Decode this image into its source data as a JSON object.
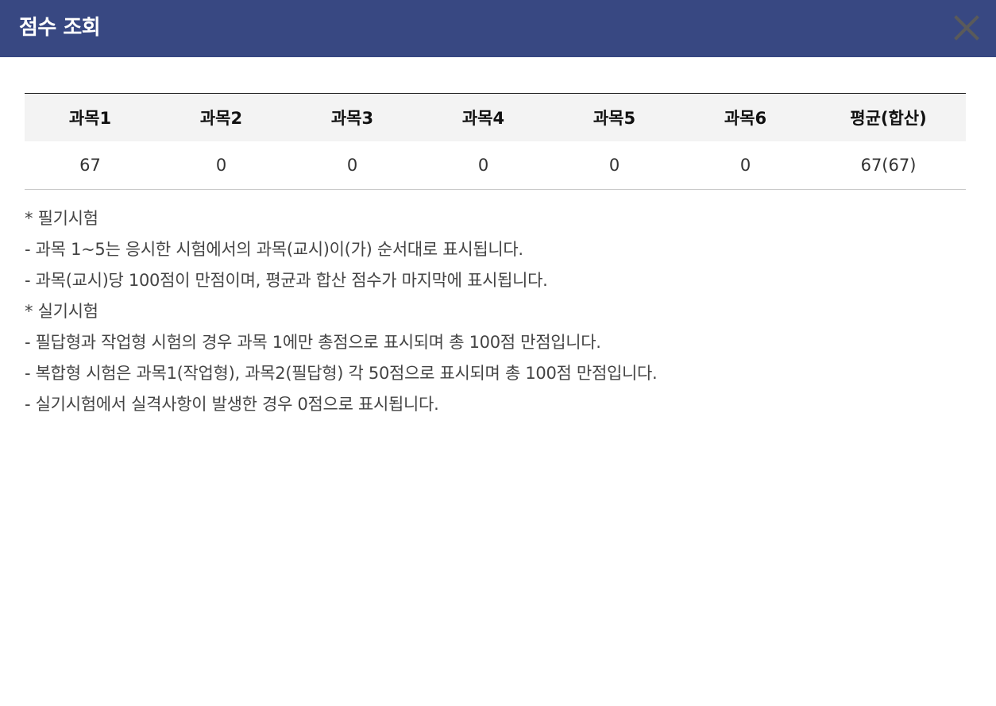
{
  "window": {
    "title": "점수 조회",
    "close_icon": "close-icon"
  },
  "table": {
    "headers": [
      "과목1",
      "과목2",
      "과목3",
      "과목4",
      "과목5",
      "과목6",
      "평균(합산)"
    ],
    "row": [
      "67",
      "0",
      "0",
      "0",
      "0",
      "0",
      "67(67)"
    ]
  },
  "notes": [
    "* 필기시험",
    "- 과목 1~5는 응시한 시험에서의 과목(교시)이(가) 순서대로 표시됩니다.",
    "- 과목(교시)당 100점이 만점이며, 평균과 합산 점수가 마지막에 표시됩니다.",
    "* 실기시험",
    "- 필답형과 작업형 시험의 경우 과목 1에만 총점으로 표시되며 총 100점 만점입니다.",
    "- 복합형 시험은 과목1(작업형), 과목2(필답형) 각 50점으로 표시되며 총 100점 만점입니다.",
    "- 실기시험에서 실격사항이 발생한 경우 0점으로 표시됩니다."
  ],
  "colors": {
    "header_bg": "#384882",
    "table_header_bg": "#f3f3f3",
    "close_icon": "#5a5a5a"
  }
}
